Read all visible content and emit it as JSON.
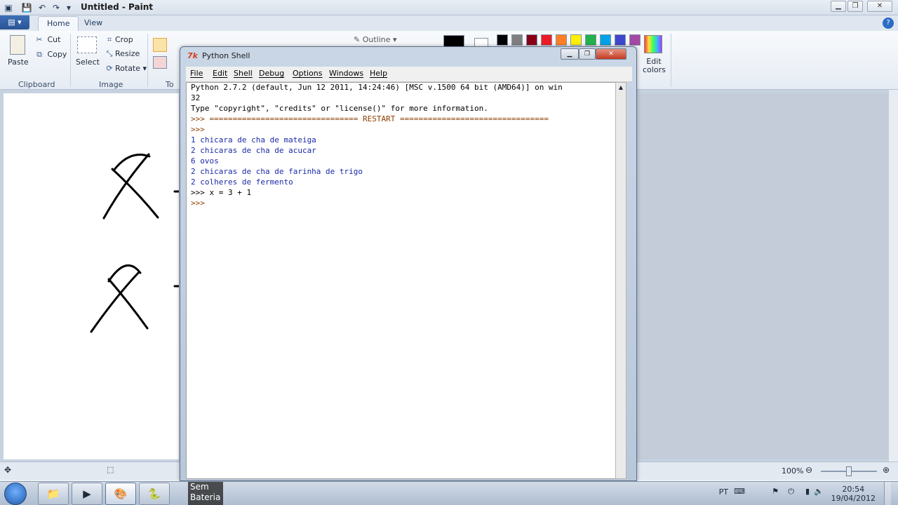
{
  "paint": {
    "title": "Untitled - Paint",
    "menu_button": "▤ ▾",
    "tabs": [
      {
        "label": "Home"
      },
      {
        "label": "View"
      }
    ],
    "help": "?",
    "clipboard": {
      "paste": "Paste",
      "cut": "Cut",
      "copy": "Copy",
      "label": "Clipboard"
    },
    "image": {
      "select": "Select",
      "crop": "Crop",
      "resize": "Resize",
      "rotate": "Rotate",
      "label": "Image"
    },
    "tools_label_partial": "To",
    "outline": "Outline",
    "edit_colors": "Edit colors",
    "palette": [
      "#000000",
      "#7f7f7f",
      "#880015",
      "#ed1c24",
      "#ff7f27",
      "#fff200",
      "#22b14c",
      "#00a2e8",
      "#3f48cc",
      "#a349a4"
    ],
    "zoom_level": "100%"
  },
  "pyshell": {
    "title": "Python Shell",
    "menus": [
      {
        "label": "File"
      },
      {
        "label": "Edit"
      },
      {
        "label": "Shell"
      },
      {
        "label": "Debug"
      },
      {
        "label": "Options"
      },
      {
        "label": "Windows"
      },
      {
        "label": "Help"
      }
    ],
    "lines": [
      {
        "text": "Python 2.7.2 (default, Jun 12 2011, 14:24:46) [MSC v.1500 64 bit (AMD64)] on win"
      },
      {
        "text": "32"
      },
      {
        "text": "Type \"copyright\", \"credits\" or \"license()\" for more information."
      },
      {
        "text": ">>> ================================ RESTART ================================"
      },
      {
        "text": ">>>"
      },
      {
        "text": "1 chicara de cha de mateiga"
      },
      {
        "text": "2 chicaras de cha de acucar"
      },
      {
        "text": "6 ovos"
      },
      {
        "text": "2 chicaras de cha de farinha de trigo"
      },
      {
        "text": "2 colheres de fermento"
      },
      {
        "text": ">>> x = 3 + 1"
      },
      {
        "text": ">>>"
      }
    ]
  },
  "taskbar": {
    "battery_tooltip": "Sem\nBateria",
    "language": "PT",
    "time": "20:54",
    "date": "19/04/2012"
  }
}
